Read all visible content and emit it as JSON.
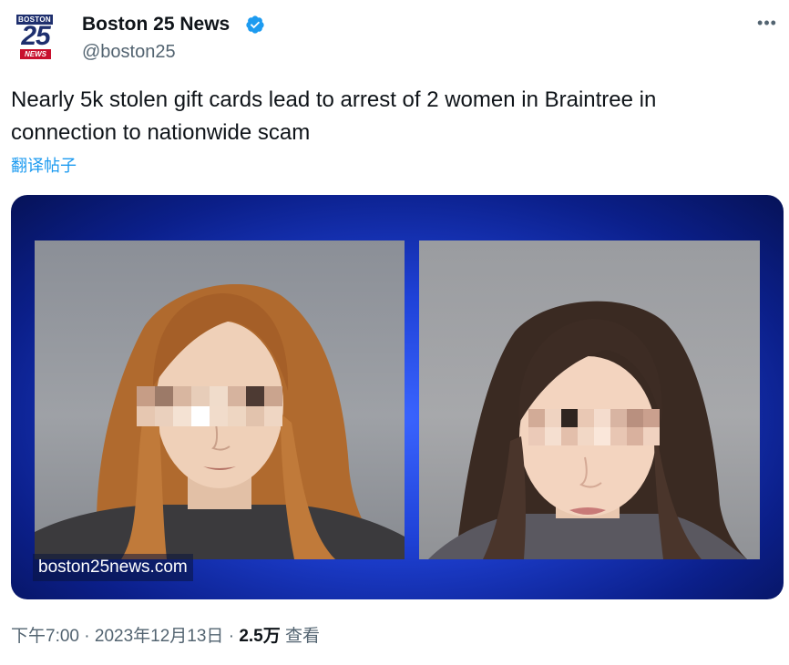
{
  "account": {
    "logo_top": "BOSTON",
    "logo_num": "25",
    "logo_bottom": "NEWS",
    "name": "Boston 25 News",
    "handle": "@boston25",
    "verified_icon": "verified-badge-icon",
    "more_icon": "more-options-icon"
  },
  "tweet": {
    "text": "Nearly 5k stolen gift cards lead to arrest of 2 women in Braintree in connection to nationwide scam",
    "translate_label": "翻译帖子"
  },
  "media": {
    "watermark": "boston25news.com",
    "background_color": "#1f42d8"
  },
  "footer": {
    "time": "下午7:00",
    "separator1": " · ",
    "date": "2023年12月13日",
    "separator2": " · ",
    "views": "2.5万",
    "views_label": " 查看"
  }
}
